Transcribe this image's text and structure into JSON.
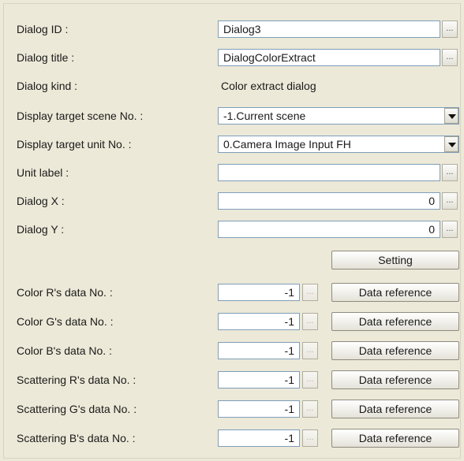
{
  "fields": {
    "dialog_id": {
      "label": "Dialog ID :",
      "value": "Dialog3"
    },
    "dialog_title": {
      "label": "Dialog title :",
      "value": "DialogColorExtract"
    },
    "dialog_kind": {
      "label": "Dialog kind :",
      "value": "Color extract dialog"
    },
    "display_scene": {
      "label": "Display target scene No. :",
      "value": "-1.Current scene"
    },
    "display_unit": {
      "label": "Display target unit No. :",
      "value": "0.Camera Image Input FH"
    },
    "unit_label": {
      "label": "Unit label :",
      "value": ""
    },
    "dialog_x": {
      "label": "Dialog X :",
      "value": "0"
    },
    "dialog_y": {
      "label": "Dialog Y :",
      "value": "0"
    }
  },
  "ellipsis_text": "...",
  "setting_button": "Setting",
  "data_rows": [
    {
      "label": "Color R's data No. :",
      "value": "-1",
      "button": "Data reference"
    },
    {
      "label": "Color G's data No. :",
      "value": "-1",
      "button": "Data reference"
    },
    {
      "label": "Color B's data No. :",
      "value": "-1",
      "button": "Data reference"
    },
    {
      "label": "Scattering R's data No. :",
      "value": "-1",
      "button": "Data reference"
    },
    {
      "label": "Scattering G's data No. :",
      "value": "-1",
      "button": "Data reference"
    },
    {
      "label": "Scattering B's data No. :",
      "value": "-1",
      "button": "Data reference"
    }
  ]
}
